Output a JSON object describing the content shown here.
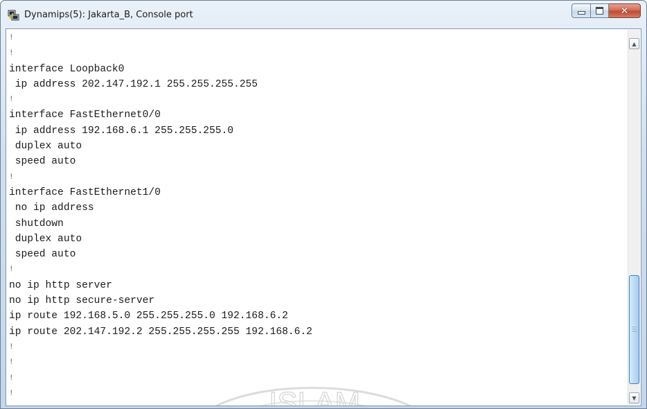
{
  "window": {
    "title": "Dynamips(5): Jakarta_B, Console port",
    "icon": "putty-terminal-icon",
    "buttons": {
      "minimize": "minimize-icon",
      "maximize": "maximize-icon",
      "close": "close-icon"
    }
  },
  "console": {
    "lines": [
      "!",
      "!",
      "interface Loopback0",
      " ip address 202.147.192.1 255.255.255.255",
      "!",
      "interface FastEthernet0/0",
      " ip address 192.168.6.1 255.255.255.0",
      " duplex auto",
      " speed auto",
      "!",
      "interface FastEthernet1/0",
      " no ip address",
      " shutdown",
      " duplex auto",
      " speed auto",
      "!",
      "no ip http server",
      "no ip http secure-server",
      "ip route 192.168.5.0 255.255.255.0 192.168.6.2",
      "ip route 202.147.192.2 255.255.255.255 192.168.6.2",
      "!",
      "!",
      "!",
      "!"
    ]
  },
  "watermark": {
    "text": "ISLAM"
  },
  "scrollbar": {
    "position": 0.86
  },
  "colors": {
    "console_bg": "#ffffff",
    "console_fg": "#1a1a1a",
    "close_button": "#c94a33"
  }
}
